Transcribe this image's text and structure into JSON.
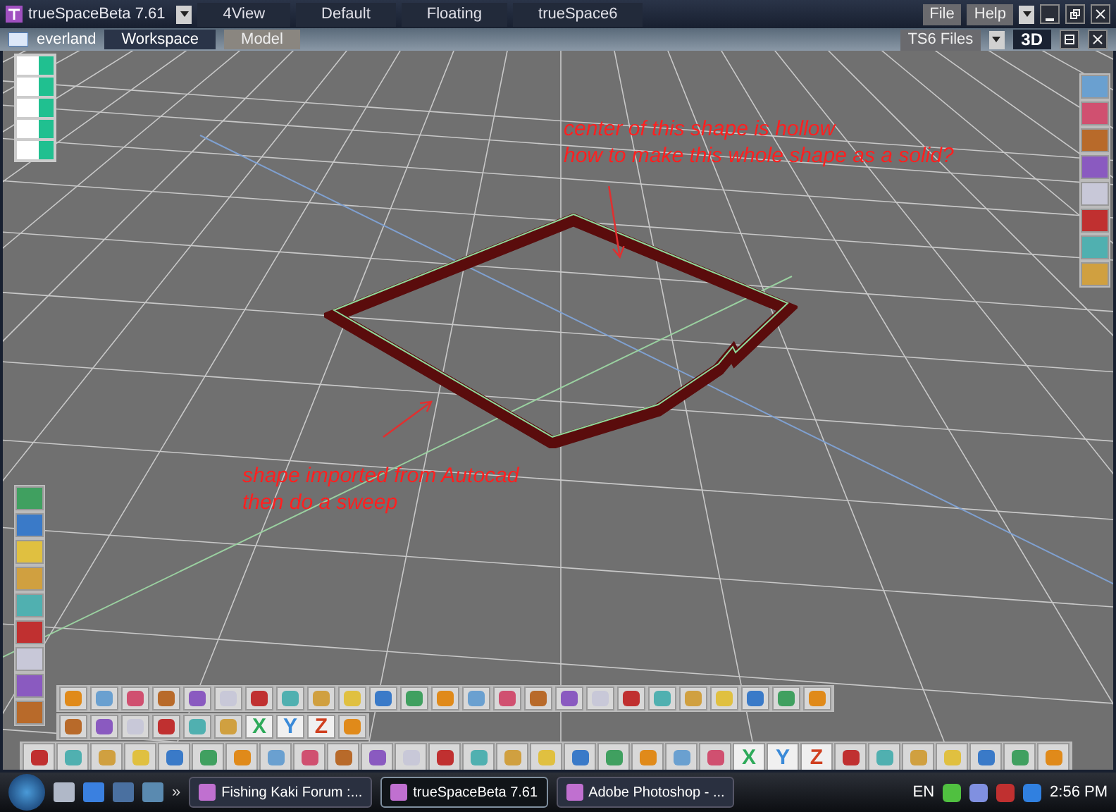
{
  "title_bar": {
    "title": "trueSpaceBeta 7.61",
    "layouts": [
      "4View",
      "Default",
      "Floating",
      "trueSpace6"
    ],
    "menus": [
      "File",
      "Help"
    ]
  },
  "scene": {
    "name": "everland"
  },
  "tabs": [
    {
      "label": "Workspace",
      "selected": true
    },
    {
      "label": "Model",
      "selected": false
    }
  ],
  "library_menu": "TS6 Files",
  "view_mode": "3D",
  "annotations": [
    {
      "lines": [
        "center of this shape is hollow",
        "how to make this whole shape as a solid?"
      ]
    },
    {
      "lines": [
        "shape imported from Autocad",
        "then do a sweep"
      ]
    }
  ],
  "toolbars": [
    [
      {
        "kind": "tool"
      },
      {
        "kind": "tool"
      },
      {
        "kind": "tool"
      },
      {
        "kind": "tool"
      },
      {
        "kind": "tool"
      },
      {
        "kind": "tool"
      },
      {
        "kind": "tool"
      },
      {
        "kind": "tool"
      },
      {
        "kind": "tool"
      },
      {
        "kind": "tool"
      },
      {
        "kind": "tool"
      },
      {
        "kind": "tool"
      },
      {
        "kind": "tool"
      },
      {
        "kind": "tool"
      },
      {
        "kind": "tool"
      },
      {
        "kind": "tool"
      },
      {
        "kind": "tool"
      },
      {
        "kind": "tool"
      },
      {
        "kind": "tool"
      },
      {
        "kind": "tool"
      },
      {
        "kind": "tool"
      },
      {
        "kind": "tool"
      },
      {
        "kind": "tool"
      },
      {
        "kind": "tool"
      },
      {
        "kind": "tool"
      }
    ],
    [
      {
        "kind": "tool"
      },
      {
        "kind": "tool"
      },
      {
        "kind": "tool"
      },
      {
        "kind": "tool"
      },
      {
        "kind": "tool"
      },
      {
        "kind": "tool"
      },
      {
        "kind": "letter",
        "text": "X"
      },
      {
        "kind": "letter",
        "text": "Y"
      },
      {
        "kind": "letter",
        "text": "Z"
      },
      {
        "kind": "tool"
      }
    ],
    [
      {
        "kind": "tool"
      },
      {
        "kind": "tool"
      },
      {
        "kind": "tool"
      },
      {
        "kind": "tool"
      },
      {
        "kind": "tool"
      },
      {
        "kind": "tool"
      },
      {
        "kind": "tool"
      },
      {
        "kind": "tool"
      },
      {
        "kind": "tool"
      },
      {
        "kind": "tool"
      },
      {
        "kind": "tool"
      },
      {
        "kind": "tool"
      },
      {
        "kind": "tool"
      },
      {
        "kind": "tool"
      },
      {
        "kind": "tool"
      },
      {
        "kind": "tool"
      },
      {
        "kind": "tool"
      },
      {
        "kind": "tool"
      },
      {
        "kind": "tool"
      },
      {
        "kind": "tool"
      },
      {
        "kind": "tool"
      },
      {
        "kind": "letter",
        "text": "X"
      },
      {
        "kind": "letter",
        "text": "Y"
      },
      {
        "kind": "letter",
        "text": "Z"
      },
      {
        "kind": "tool"
      },
      {
        "kind": "tool"
      },
      {
        "kind": "tool"
      },
      {
        "kind": "tool"
      },
      {
        "kind": "tool"
      },
      {
        "kind": "tool"
      },
      {
        "kind": "tool"
      }
    ]
  ],
  "taskbar": {
    "overflow": "»",
    "windows": [
      {
        "label": "Fishing Kaki Forum :...",
        "selected": false
      },
      {
        "label": "trueSpaceBeta 7.61",
        "selected": true
      },
      {
        "label": "Adobe Photoshop - ...",
        "selected": false
      }
    ],
    "language": "EN",
    "clock": "2:56 PM"
  }
}
